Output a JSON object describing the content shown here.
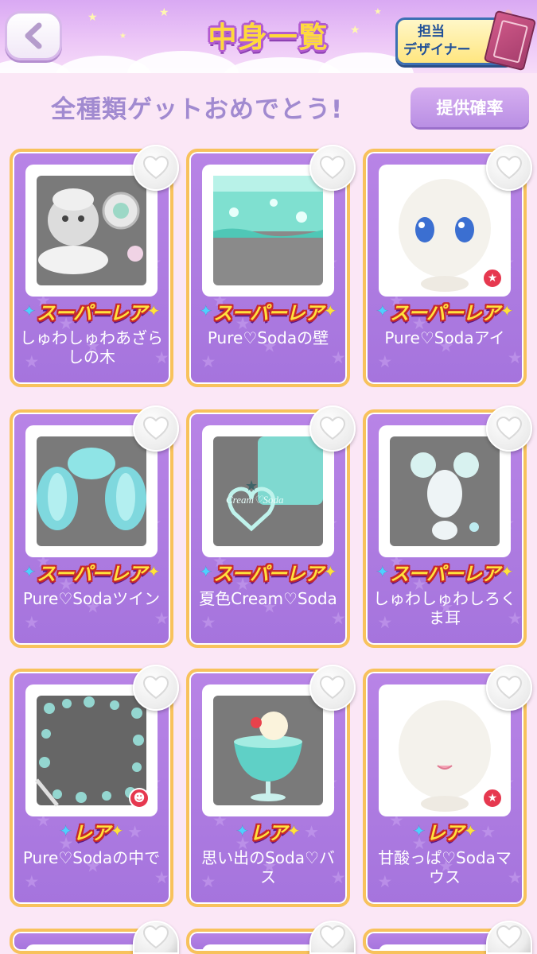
{
  "header": {
    "back_label": "‹",
    "title": "中身一覧",
    "designer_line1": "担当",
    "designer_line2": "デザイナー"
  },
  "subheader": {
    "congrats": "全種類ゲットおめでとう!",
    "odds_button": "提供確率"
  },
  "items": [
    {
      "name": "しゅわしゅわあざらしの木",
      "rarity": "スーパーレア",
      "art": "seal-tree",
      "badge": ""
    },
    {
      "name": "Pure♡Sodaの壁",
      "rarity": "スーパーレア",
      "art": "wall",
      "badge": ""
    },
    {
      "name": "Pure♡Sodaアイ",
      "rarity": "スーパーレア",
      "art": "eye",
      "badge": "star"
    },
    {
      "name": "Pure♡Sodaツイン",
      "rarity": "スーパーレア",
      "art": "twin",
      "badge": ""
    },
    {
      "name": "夏色Cream♡Soda",
      "rarity": "スーパーレア",
      "art": "cream-soda",
      "badge": ""
    },
    {
      "name": "しゅわしゅわしろくま耳",
      "rarity": "スーパーレア",
      "art": "bear-ears",
      "badge": ""
    },
    {
      "name": "Pure♡Sodaの中で",
      "rarity": "レア",
      "art": "bubble-frame",
      "badge": "person"
    },
    {
      "name": "思い出のSoda♡バス",
      "rarity": "レア",
      "art": "soda-glass",
      "badge": ""
    },
    {
      "name": "甘酸っぱ♡Sodaマウス",
      "rarity": "レア",
      "art": "mouth",
      "badge": "star"
    }
  ],
  "colors": {
    "card": "#b080e4",
    "card_border": "#f8c25c",
    "page_bg": "#fbe7f6",
    "title_yellow": "#ffd93a"
  },
  "icons": {
    "back": "back-chevron-icon",
    "heart": "heart-icon",
    "badge_star": "star-badge-icon",
    "badge_person": "avatar-badge-icon"
  }
}
